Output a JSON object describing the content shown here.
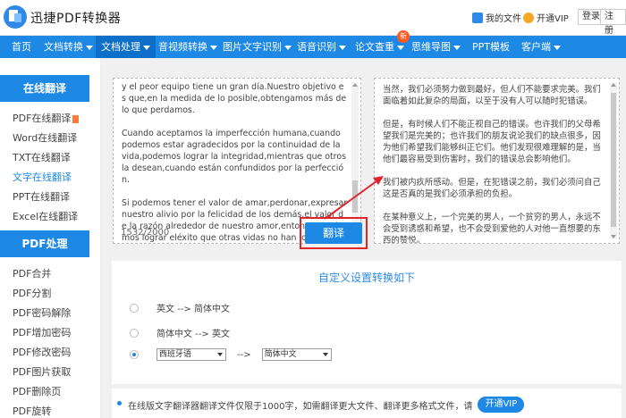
{
  "header": {
    "brand": "迅捷PDF转换器",
    "my_files": "我的文件",
    "vip": "开通VIP",
    "login": "登录",
    "register": "注册"
  },
  "nav": {
    "items": [
      "首页",
      "文档转换",
      "文档处理",
      "音视频转换",
      "图片文字识别",
      "语音识别",
      "论文查重",
      "思维导图",
      "PPT模板",
      "客户端"
    ],
    "new_badge": "新"
  },
  "sidebar": {
    "section1": "在线翻译",
    "items1": [
      "PDF在线翻译",
      "Word在线翻译",
      "TXT在线翻译",
      "文字在线翻译",
      "PPT在线翻译",
      "Excel在线翻译"
    ],
    "section2": "PDF处理",
    "items2": [
      "PDF合并",
      "PDF分割",
      "PDF密码解除",
      "PDF增加密码",
      "PDF修改密码",
      "PDF图片获取",
      "PDF删除页",
      "PDF旋转"
    ]
  },
  "source": {
    "text": "y el peor equipo tiene un gran día.Nuestro objetivo es que,en la medida de lo posible,obtengamos más de lo que perdamos.\n\nCuando aceptamos la imperfección humana,cuando podemos estar agradecidos por la continuidad de la vida,podemos lograr la integridad,mientras que otros la desean,cuando están confundidos por la perfección.\n\nSi podemos tener el valor de amar,perdonar,expresar nuestro alivio por la felicidad de los demás,el valor de la razón alrededor de nuestro amor,entonces podemos lograr eléxito que otras vidas no han logrado.",
    "count": "1532/2000"
  },
  "translate_button": "翻译",
  "result": {
    "text": "当然，我们必须努力做到最好，但人们不能要求完美。我们面临着如此复杂的局面，以至于没有人可以随时犯错误。\n\n但是，有时候人们不能正视自己的错误。也许我们的父母希望我们是完美的；也许我们的朋友说论我们的缺点很多，因为他们希望我们能够纠正它们。他们发现很难理解的是，当他们最容易受到伤害时，我们的错误总会影响他们。\n\n我们被内疚所感动。但是，在犯错误之前，我们必须问自己这是否真的是我们必须承担的负担。\n\n在某种意义上，一个完美的男人，一个贫穷的男人，永远不会受到诱惑和希望，也不会受到爱他的人对他一直想要的东西的赞悦。\n\n一个有勇气放弃自己无法实现的梦想的男人是不可分割的；一个能够坚定地面对失去亲人的痛苦的人，因为他清楚了最严重的痛苦并找到"
  },
  "settings": {
    "title": "自定义设置转换如下",
    "option1": "英文 --> 简体中文",
    "option2": "简体中文 --> 英文",
    "from_lang": "西班牙语",
    "arrow": "-->",
    "to_lang": "简体中文"
  },
  "notice": {
    "text": "在线版文字翻译器翻译文件仅限于1000字，如需翻译更大文件、翻译更多格式文件，请",
    "vip_button": "开通VIP"
  },
  "colors": {
    "primary": "#1e88e5",
    "highlight": "#e0242a"
  }
}
